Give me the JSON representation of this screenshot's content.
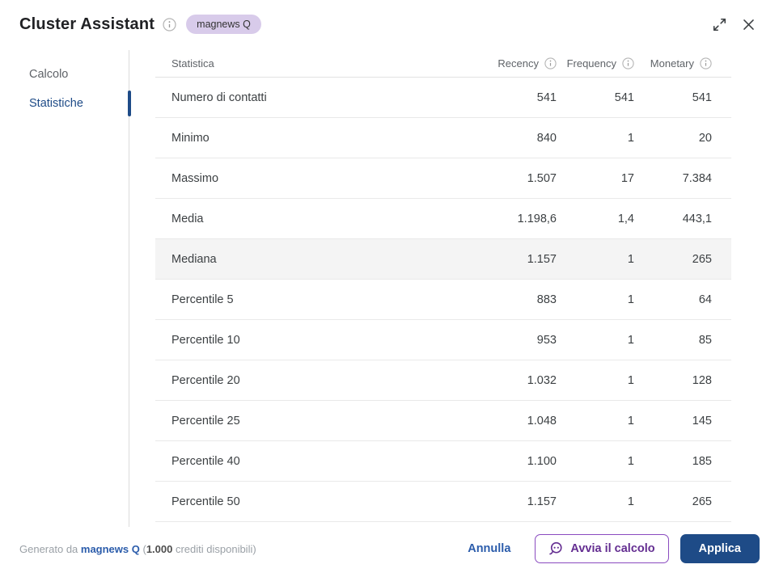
{
  "header": {
    "title": "Cluster Assistant",
    "badge": "magnews Q"
  },
  "sidebar": {
    "items": [
      {
        "label": "Calcolo",
        "active": false
      },
      {
        "label": "Statistiche",
        "active": true
      }
    ]
  },
  "table": {
    "columns": [
      {
        "label": "Statistica",
        "has_info": false
      },
      {
        "label": "Recency",
        "has_info": true
      },
      {
        "label": "Frequency",
        "has_info": true
      },
      {
        "label": "Monetary",
        "has_info": true
      }
    ],
    "rows": [
      {
        "label": "Numero di contatti",
        "recency": "541",
        "frequency": "541",
        "monetary": "541",
        "highlighted": false
      },
      {
        "label": "Minimo",
        "recency": "840",
        "frequency": "1",
        "monetary": "20",
        "highlighted": false
      },
      {
        "label": "Massimo",
        "recency": "1.507",
        "frequency": "17",
        "monetary": "7.384",
        "highlighted": false
      },
      {
        "label": "Media",
        "recency": "1.198,6",
        "frequency": "1,4",
        "monetary": "443,1",
        "highlighted": false
      },
      {
        "label": "Mediana",
        "recency": "1.157",
        "frequency": "1",
        "monetary": "265",
        "highlighted": true
      },
      {
        "label": "Percentile 5",
        "recency": "883",
        "frequency": "1",
        "monetary": "64",
        "highlighted": false
      },
      {
        "label": "Percentile 10",
        "recency": "953",
        "frequency": "1",
        "monetary": "85",
        "highlighted": false
      },
      {
        "label": "Percentile 20",
        "recency": "1.032",
        "frequency": "1",
        "monetary": "128",
        "highlighted": false
      },
      {
        "label": "Percentile 25",
        "recency": "1.048",
        "frequency": "1",
        "monetary": "145",
        "highlighted": false
      },
      {
        "label": "Percentile 40",
        "recency": "1.100",
        "frequency": "1",
        "monetary": "185",
        "highlighted": false
      },
      {
        "label": "Percentile 50",
        "recency": "1.157",
        "frequency": "1",
        "monetary": "265",
        "highlighted": false
      }
    ]
  },
  "footer": {
    "generated_prefix": "Generato da ",
    "brand": "magnews Q",
    "credits_mid": " (",
    "credits_value": "1.000",
    "credits_suffix": " crediti disponibili)",
    "cancel_label": "Annulla",
    "run_label": "Avvia il calcolo",
    "apply_label": "Applica"
  },
  "colors": {
    "accent_blue": "#1e4b87",
    "link_blue": "#2b5cab",
    "accent_purple": "#642e91",
    "purple_border": "#8a4bc0",
    "badge_bg": "#d8cbea",
    "row_highlight": "#f4f4f4"
  }
}
